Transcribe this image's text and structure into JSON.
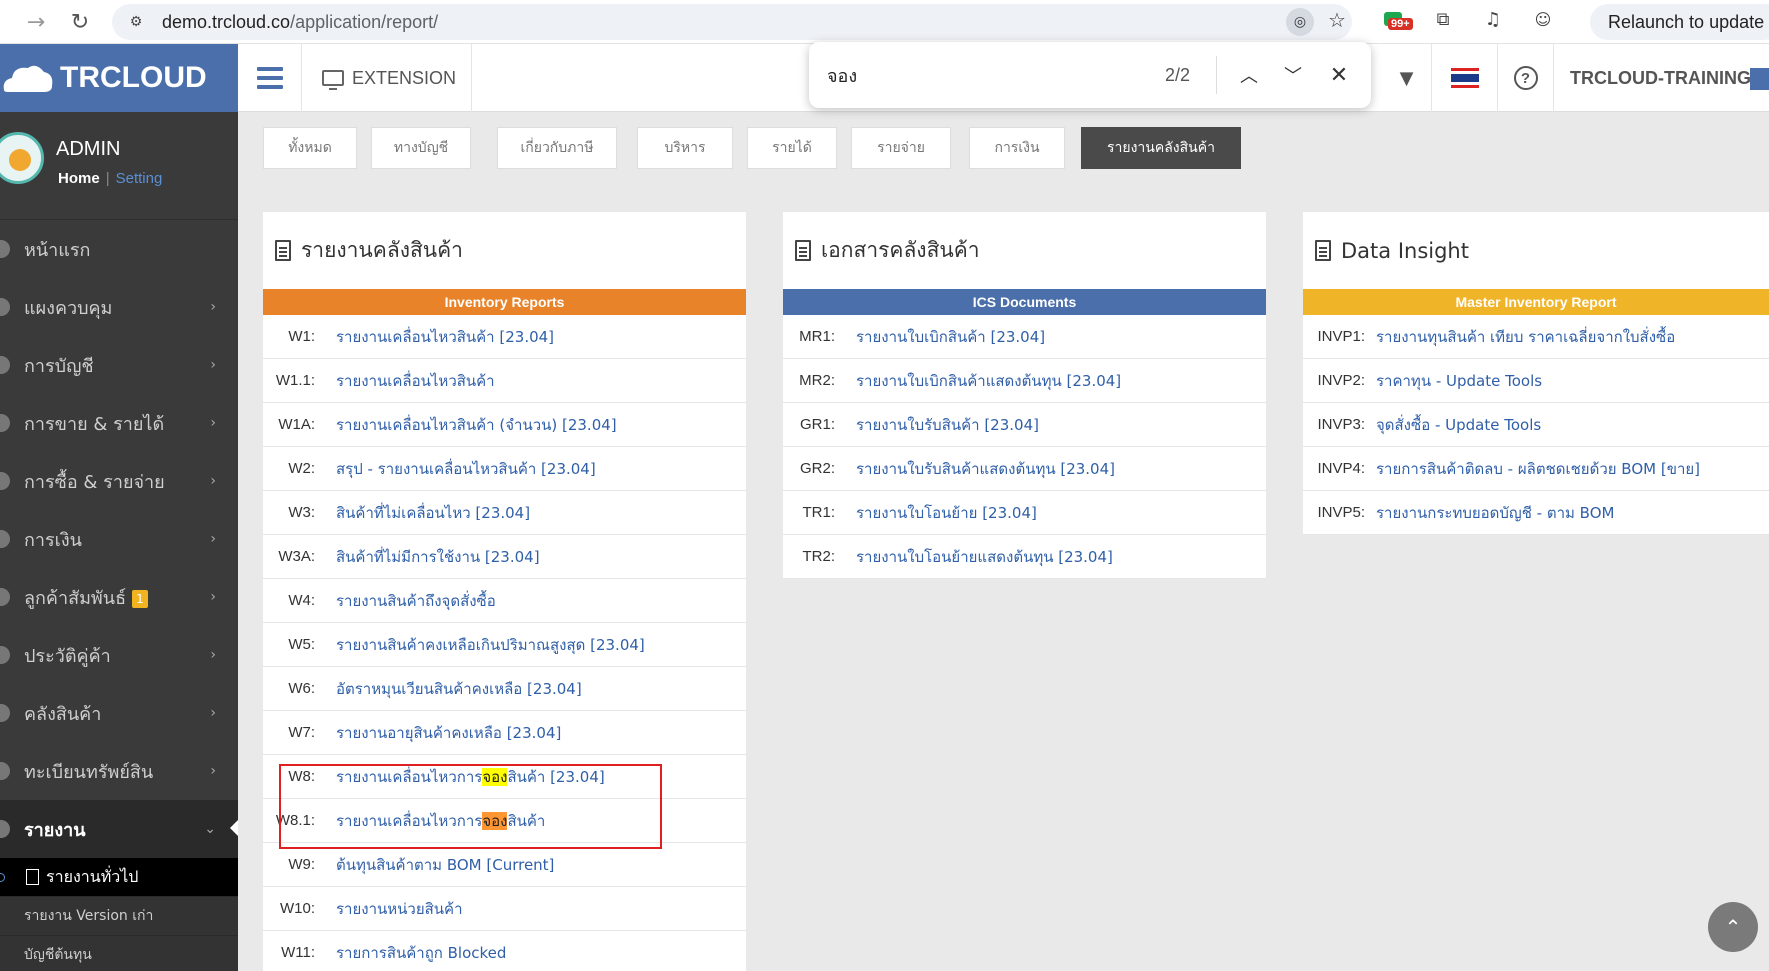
{
  "browser": {
    "url_host": "demo.trcloud.co",
    "url_path": "/application/report/",
    "ext_badge": "99+",
    "relaunch_label": "Relaunch to update"
  },
  "findbar": {
    "query": "จอง",
    "count": "2/2"
  },
  "header": {
    "logo_text": "TRCLOUD",
    "extension_label": "EXTENSION",
    "company": "TRCLOUD-TRAINING"
  },
  "profile": {
    "name": "ADMIN",
    "home": "Home",
    "separator": "|",
    "setting": "Setting"
  },
  "sidebar": {
    "items": [
      {
        "label": "หน้าแรก",
        "chevron": false
      },
      {
        "label": "แผงควบคุม",
        "chevron": true
      },
      {
        "label": "การบัญชี",
        "chevron": true
      },
      {
        "label": "การขาย & รายได้",
        "chevron": true
      },
      {
        "label": "การซื้อ & รายจ่าย",
        "chevron": true
      },
      {
        "label": "การเงิน",
        "chevron": true
      },
      {
        "label": "ลูกค้าสัมพันธ์",
        "chevron": true,
        "badge": "1"
      },
      {
        "label": "ประวัติคู่ค้า",
        "chevron": true
      },
      {
        "label": "คลังสินค้า",
        "chevron": true
      },
      {
        "label": "ทะเบียนทรัพย์สิน",
        "chevron": true
      },
      {
        "label": "รายงาน",
        "chevron": true,
        "active": true
      }
    ],
    "submenu": [
      {
        "label": "รายงานทั่วไป",
        "active": true
      },
      {
        "label": "รายงาน Version เก่า"
      },
      {
        "label": "บัญชีต้นทุน"
      }
    ]
  },
  "tabs": [
    "ทั้งหมด",
    "ทางบัญชี",
    "เกี่ยวกับภาษี",
    "บริหาร",
    "รายได้",
    "รายจ่าย",
    "การเงิน",
    "รายงานคลังสินค้า"
  ],
  "active_tab": "รายงานคลังสินค้า",
  "panels": [
    {
      "title": "รายงานคลังสินค้า",
      "header": "Inventory Reports",
      "header_color": "#e8832a",
      "rows": [
        {
          "code": "W1:",
          "label": "รายงานเคลื่อนไหวสินค้า [23.04]"
        },
        {
          "code": "W1.1:",
          "label": "รายงานเคลื่อนไหวสินค้า"
        },
        {
          "code": "W1A:",
          "label": "รายงานเคลื่อนไหวสินค้า (จำนวน) [23.04]"
        },
        {
          "code": "W2:",
          "label": "สรุป - รายงานเคลื่อนไหวสินค้า [23.04]"
        },
        {
          "code": "W3:",
          "label": "สินค้าที่ไม่เคลื่อนไหว [23.04]"
        },
        {
          "code": "W3A:",
          "label": "สินค้าที่ไม่มีการใช้งาน [23.04]"
        },
        {
          "code": "W4:",
          "label": "รายงานสินค้าถึงจุดสั่งซื้อ"
        },
        {
          "code": "W5:",
          "label": "รายงานสินค้าคงเหลือเกินปริมาณสูงสุด [23.04]"
        },
        {
          "code": "W6:",
          "label": "อัตราหมุนเวียนสินค้าคงเหลือ [23.04]"
        },
        {
          "code": "W7:",
          "label": "รายงานอายุสินค้าคงเหลือ [23.04]"
        },
        {
          "code": "W8:",
          "label": "รายงานเคลื่อนไหวการจองสินค้า [23.04]",
          "pre": "รายงานเคลื่อนไหวการ",
          "hit": "จอง",
          "post": "สินค้า [23.04]",
          "hit_style": "y"
        },
        {
          "code": "W8.1:",
          "label": "รายงานเคลื่อนไหวการจองสินค้า",
          "pre": "รายงานเคลื่อนไหวการ",
          "hit": "จอง",
          "post": "สินค้า",
          "hit_style": "o"
        },
        {
          "code": "W9:",
          "label": "ต้นทุนสินค้าตาม BOM [Current]"
        },
        {
          "code": "W10:",
          "label": "รายงานหน่วยสินค้า"
        },
        {
          "code": "W11:",
          "label": "รายการสินค้าถูก Blocked"
        }
      ]
    },
    {
      "title": "เอกสารคลังสินค้า",
      "header": "ICS Documents",
      "header_color": "#4b6faa",
      "rows": [
        {
          "code": "MR1:",
          "label": "รายงานใบเบิกสินค้า [23.04]"
        },
        {
          "code": "MR2:",
          "label": "รายงานใบเบิกสินค้าแสดงต้นทุน [23.04]"
        },
        {
          "code": "GR1:",
          "label": "รายงานใบรับสินค้า [23.04]"
        },
        {
          "code": "GR2:",
          "label": "รายงานใบรับสินค้าแสดงต้นทุน [23.04]"
        },
        {
          "code": "TR1:",
          "label": "รายงานใบโอนย้าย [23.04]"
        },
        {
          "code": "TR2:",
          "label": "รายงานใบโอนย้ายแสดงต้นทุน [23.04]"
        }
      ]
    },
    {
      "title": "Data Insight",
      "header": "Master Inventory Report",
      "header_color": "#f0b429",
      "rows": [
        {
          "code": "INVP1:",
          "label": "รายงานทุนสินค้า เทียบ ราคาเฉลี่ยจากใบสั่งซื้อ"
        },
        {
          "code": "INVP2:",
          "label": "ราคาทุน - Update Tools"
        },
        {
          "code": "INVP3:",
          "label": "จุดสั่งซื้อ - Update Tools"
        },
        {
          "code": "INVP4:",
          "label": "รายการสินค้าติดลบ - ผลิตชดเชยด้วย BOM [ขาย]"
        },
        {
          "code": "INVP5:",
          "label": "รายงานกระทบยอดบัญชี - ตาม BOM"
        }
      ]
    }
  ]
}
